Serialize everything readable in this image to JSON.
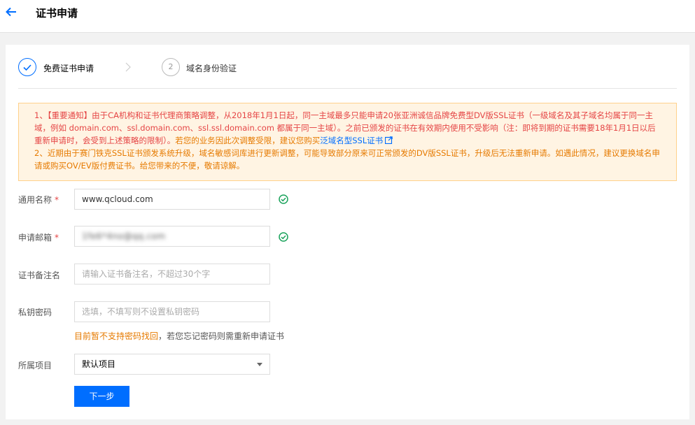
{
  "header": {
    "title": "证书申请"
  },
  "steps": [
    {
      "number": "1",
      "label": "免费证书申请",
      "status": "done"
    },
    {
      "number": "2",
      "label": "域名身份验证",
      "status": "pending"
    }
  ],
  "notice": {
    "line1_red": "1、【重要通知】由于CA机构和证书代理商策略调整，从2018年1月1日起，同一主域最多只能申请20张亚洲诚信品牌免费型DV版SSL证书（一级域名及其子域名均属于同一主域，例如 domain.com、ssl.domain.com、ssl.ssl.domain.com 都属于同一主域）。之前已颁发的证书在有效期内使用不受影响（注：即将到期的证书需要18年1月1日以后重新申请时，会受到上述策略的限制）。",
    "line1_orange": "若您的业务因此次调整受限，建议您购买",
    "line1_link": "泛域名型SSL证书",
    "line2_orange": "2、近期由于赛门铁克SSL证书颁发系统升级，域名敏感词库进行更新调整，可能导致部分原来可正常颁发的DV版SSL证书，升级后无法重新申请。如遇此情况，建议更换域名申请或购买OV/EV版付费证书。给您带来的不便，敬请谅解。"
  },
  "form": {
    "common_name": {
      "label": "通用名称",
      "required_mark": "*",
      "value": "www.qcloud.com"
    },
    "email": {
      "label": "申请邮箱",
      "required_mark": "*",
      "value": "1fe6*4no@qq.com"
    },
    "remark": {
      "label": "证书备注名",
      "placeholder": "请输入证书备注名，不超过30个字"
    },
    "private_key_password": {
      "label": "私钥密码",
      "placeholder": "选填，不填写则不设置私钥密码"
    },
    "password_hint_warn": "目前暂不支持密码找回",
    "password_hint_rest": "，若您忘记密码则需重新申请证书",
    "project": {
      "label": "所属项目",
      "value": "默认项目"
    }
  },
  "actions": {
    "next_label": "下一步"
  },
  "colors": {
    "primary": "#006eff",
    "success": "#1ba35c",
    "warning": "#e67a00",
    "danger": "#e54545"
  }
}
